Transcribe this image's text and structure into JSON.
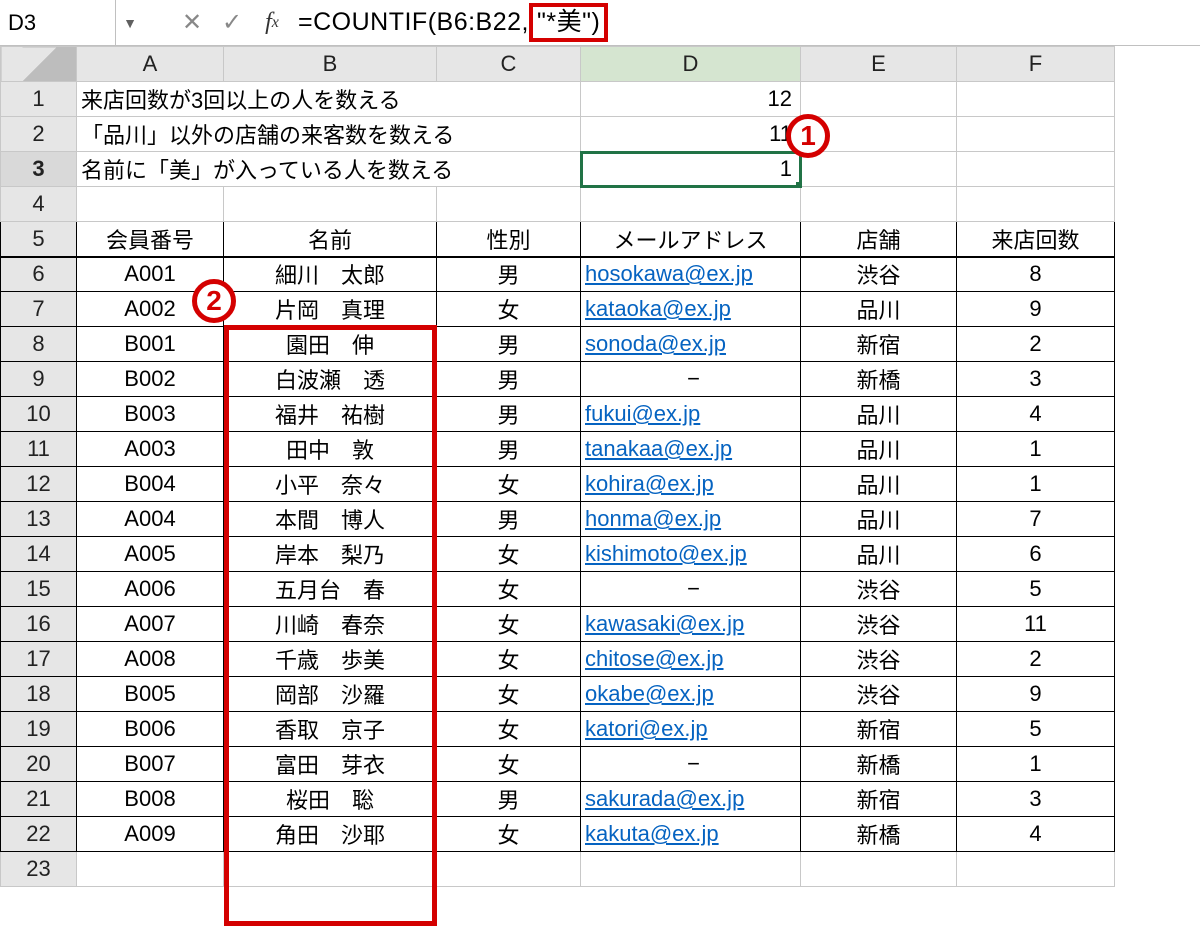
{
  "name_box": "D3",
  "formula": {
    "prefix": "=COUNTIF(B6:B22,",
    "highlight": "\"*美\")"
  },
  "annotations": {
    "one": "1",
    "two": "2"
  },
  "columns": [
    "A",
    "B",
    "C",
    "D",
    "E",
    "F"
  ],
  "top_rows": [
    {
      "row": 1,
      "label": "来店回数が3回以上の人を数える",
      "value": "12"
    },
    {
      "row": 2,
      "label": "「品川」以外の店舗の来客数を数える",
      "value": "11"
    },
    {
      "row": 3,
      "label": "名前に「美」が入っている人を数える",
      "value": "1",
      "active": true
    }
  ],
  "headers": {
    "A": "会員番号",
    "B": "名前",
    "C": "性別",
    "D": "メールアドレス",
    "E": "店舗",
    "F": "来店回数"
  },
  "rows": [
    {
      "r": 6,
      "A": "A001",
      "B": "細川　太郎",
      "C": "男",
      "D": "hosokawa@ex.jp",
      "E": "渋谷",
      "F": "8",
      "link": true
    },
    {
      "r": 7,
      "A": "A002",
      "B": "片岡　真理",
      "C": "女",
      "D": "kataoka@ex.jp",
      "E": "品川",
      "F": "9",
      "link": true
    },
    {
      "r": 8,
      "A": "B001",
      "B": "園田　伸",
      "C": "男",
      "D": "sonoda@ex.jp",
      "E": "新宿",
      "F": "2",
      "link": true
    },
    {
      "r": 9,
      "A": "B002",
      "B": "白波瀬　透",
      "C": "男",
      "D": "−",
      "E": "新橋",
      "F": "3",
      "link": false
    },
    {
      "r": 10,
      "A": "B003",
      "B": "福井　祐樹",
      "C": "男",
      "D": "fukui@ex.jp",
      "E": "品川",
      "F": "4",
      "link": true
    },
    {
      "r": 11,
      "A": "A003",
      "B": "田中　敦",
      "C": "男",
      "D": "tanakaa@ex.jp",
      "E": "品川",
      "F": "1",
      "link": true
    },
    {
      "r": 12,
      "A": "B004",
      "B": "小平　奈々",
      "C": "女",
      "D": "kohira@ex.jp",
      "E": "品川",
      "F": "1",
      "link": true
    },
    {
      "r": 13,
      "A": "A004",
      "B": "本間　博人",
      "C": "男",
      "D": "honma@ex.jp",
      "E": "品川",
      "F": "7",
      "link": true
    },
    {
      "r": 14,
      "A": "A005",
      "B": "岸本　梨乃",
      "C": "女",
      "D": "kishimoto@ex.jp",
      "E": "品川",
      "F": "6",
      "link": true
    },
    {
      "r": 15,
      "A": "A006",
      "B": "五月台　春",
      "C": "女",
      "D": "−",
      "E": "渋谷",
      "F": "5",
      "link": false
    },
    {
      "r": 16,
      "A": "A007",
      "B": "川崎　春奈",
      "C": "女",
      "D": "kawasaki@ex.jp",
      "E": "渋谷",
      "F": "11",
      "link": true
    },
    {
      "r": 17,
      "A": "A008",
      "B": "千歳　歩美",
      "C": "女",
      "D": "chitose@ex.jp",
      "E": "渋谷",
      "F": "2",
      "link": true
    },
    {
      "r": 18,
      "A": "B005",
      "B": "岡部　沙羅",
      "C": "女",
      "D": "okabe@ex.jp",
      "E": "渋谷",
      "F": "9",
      "link": true
    },
    {
      "r": 19,
      "A": "B006",
      "B": "香取　京子",
      "C": "女",
      "D": "katori@ex.jp",
      "E": "新宿",
      "F": "5",
      "link": true
    },
    {
      "r": 20,
      "A": "B007",
      "B": "富田　芽衣",
      "C": "女",
      "D": "−",
      "E": "新橋",
      "F": "1",
      "link": false
    },
    {
      "r": 21,
      "A": "B008",
      "B": "桜田　聡",
      "C": "男",
      "D": "sakurada@ex.jp",
      "E": "新宿",
      "F": "3",
      "link": true
    },
    {
      "r": 22,
      "A": "A009",
      "B": "角田　沙耶",
      "C": "女",
      "D": "kakuta@ex.jp",
      "E": "新橋",
      "F": "4",
      "link": true
    }
  ],
  "empty_row": 23
}
